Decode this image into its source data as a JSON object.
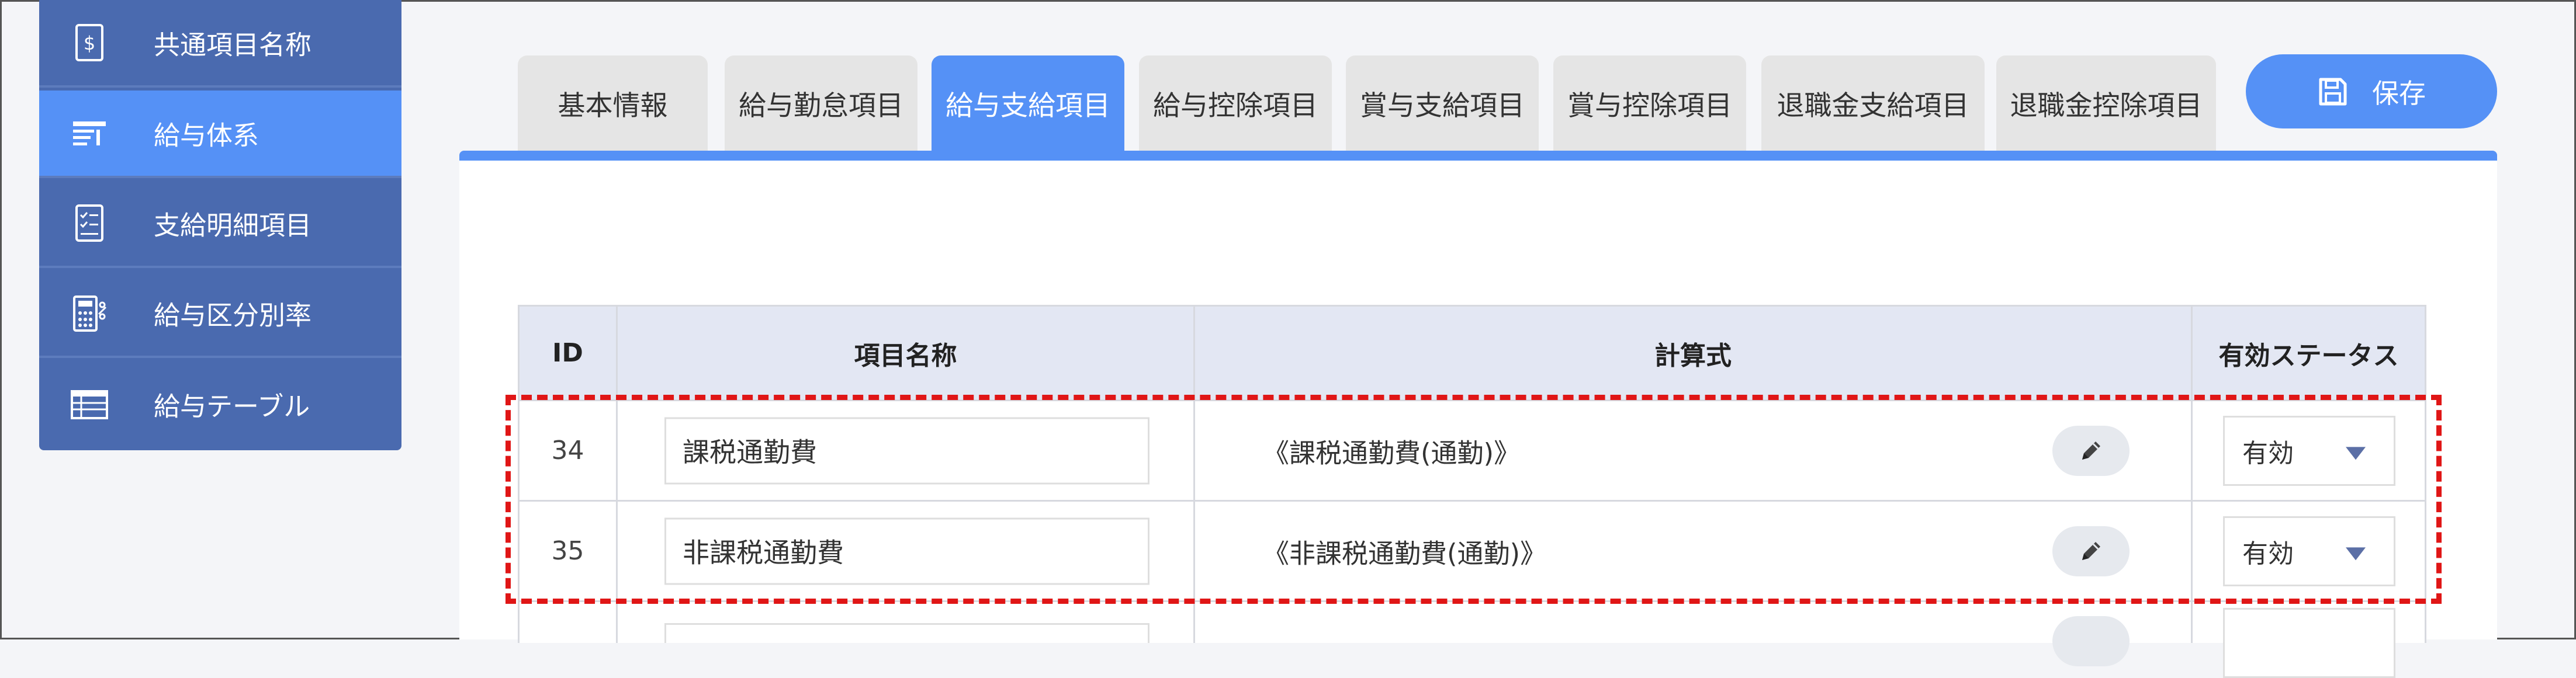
{
  "sidebar": {
    "items": [
      {
        "label": "共通項目名称",
        "icon": "dollar-document-icon",
        "active": false
      },
      {
        "label": "給与体系",
        "icon": "payroll-structure-icon",
        "active": true
      },
      {
        "label": "支給明細項目",
        "icon": "checklist-icon",
        "active": false
      },
      {
        "label": "給与区分別率",
        "icon": "calculator-icon",
        "active": false
      },
      {
        "label": "給与テーブル",
        "icon": "table-list-icon",
        "active": false
      }
    ]
  },
  "tabs": [
    {
      "label": "基本情報",
      "active": false
    },
    {
      "label": "給与勤怠項目",
      "active": false
    },
    {
      "label": "給与支給項目",
      "active": true
    },
    {
      "label": "給与控除項目",
      "active": false
    },
    {
      "label": "賞与支給項目",
      "active": false
    },
    {
      "label": "賞与控除項目",
      "active": false
    },
    {
      "label": "退職金支給項目",
      "active": false
    },
    {
      "label": "退職金控除項目",
      "active": false
    }
  ],
  "save_button": {
    "label": "保存",
    "icon": "floppy-disk-icon"
  },
  "table": {
    "headers": [
      "ID",
      "項目名称",
      "計算式",
      "有効ステータス"
    ],
    "rows": [
      {
        "id": "34",
        "name": "課税通勤費",
        "formula": "《課税通勤費(通勤)》",
        "status": "有効"
      },
      {
        "id": "35",
        "name": "非課税通勤費",
        "formula": "《非課税通勤費(通勤)》",
        "status": "有効"
      },
      {
        "id": "",
        "name": "",
        "formula": "",
        "status": ""
      }
    ]
  },
  "colors": {
    "accent": "#5591f6",
    "sidebar_bg": "#4a6aaf",
    "header_bg": "#e3e7f3",
    "highlight": "#e01616"
  }
}
